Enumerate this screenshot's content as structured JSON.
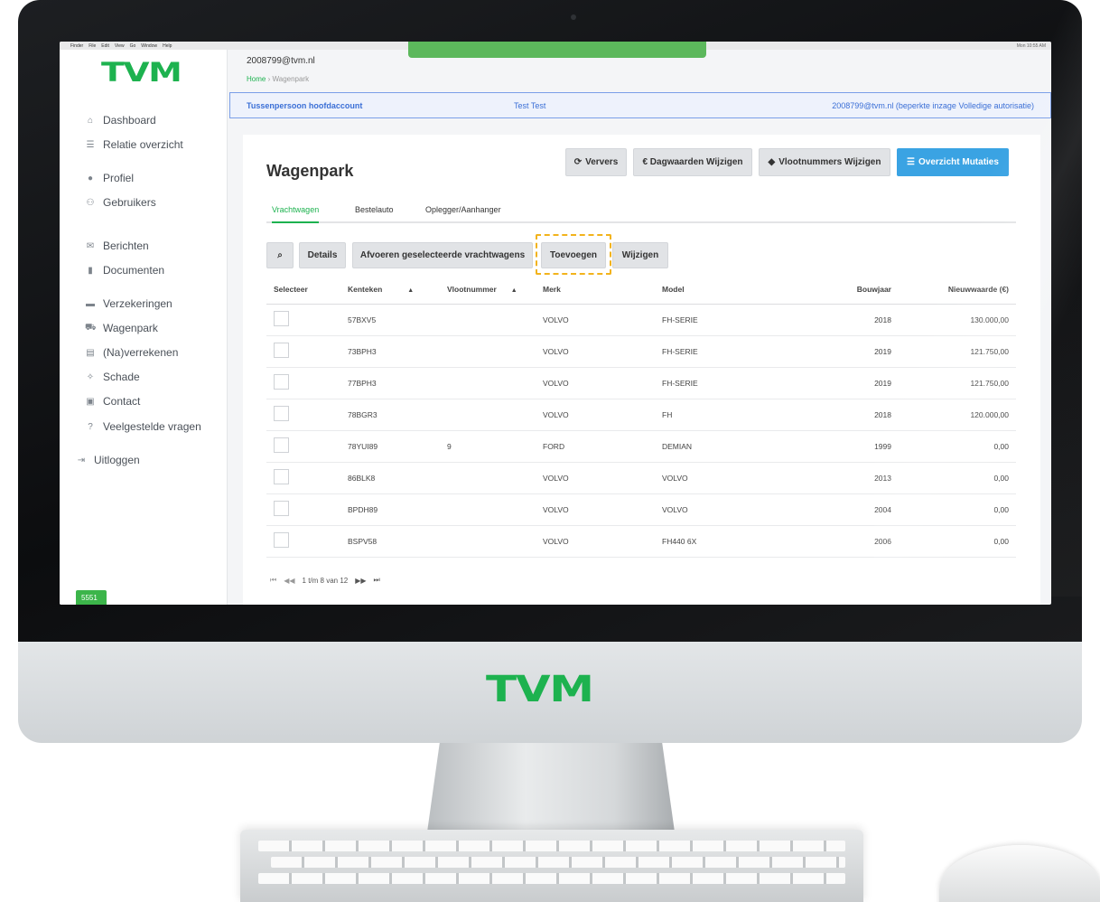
{
  "brand": {
    "logo": "TVM",
    "accent": "#1db24f",
    "info_blue": "#3b6fd6",
    "highlight": "#f2b31c"
  },
  "os_menubar": {
    "items": [
      "Finder",
      "File",
      "Edit",
      "View",
      "Go",
      "Window",
      "Help"
    ],
    "clock": "Mon 10:55 AM"
  },
  "top_banner": "",
  "sidebar": {
    "items": [
      {
        "label": "Dashboard",
        "icon": "home-icon",
        "glyph": "⌂"
      },
      {
        "label": "Relatie overzicht",
        "icon": "list-icon",
        "glyph": "☰"
      },
      {
        "label": "Profiel",
        "icon": "user-icon",
        "glyph": "●"
      },
      {
        "label": "Gebruikers",
        "icon": "users-icon",
        "glyph": "⚇"
      },
      {
        "label": "Berichten",
        "icon": "envelope-icon",
        "glyph": "✉"
      },
      {
        "label": "Documenten",
        "icon": "file-icon",
        "glyph": "▮"
      },
      {
        "label": "Verzekeringen",
        "icon": "folder-icon",
        "glyph": "▬"
      },
      {
        "label": "Wagenpark",
        "icon": "truck-icon",
        "glyph": "⛟"
      },
      {
        "label": "(Na)verrekenen",
        "icon": "calculator-icon",
        "glyph": "▤"
      },
      {
        "label": "Schade",
        "icon": "car-crash-icon",
        "glyph": "✧"
      },
      {
        "label": "Contact",
        "icon": "contact-card-icon",
        "glyph": "▣"
      },
      {
        "label": "Veelgestelde vragen",
        "icon": "question-icon",
        "glyph": "?"
      }
    ],
    "logout": {
      "label": "Uitloggen",
      "icon": "sign-out-icon",
      "glyph": "⇥"
    },
    "version": "5551"
  },
  "header": {
    "user_email": "2008799@tvm.nl",
    "breadcrumb": {
      "home": "Home",
      "separator": "›",
      "current": "Wagenpark"
    }
  },
  "infobar": {
    "account_type": "Tussenpersoon hoofdaccount",
    "name": "Test Test",
    "authorization": "2008799@tvm.nl (beperkte inzage Volledige autorisatie)"
  },
  "page": {
    "title": "Wagenpark",
    "actions": {
      "refresh": "Ververs",
      "day_values": "€ Dagwaarden Wijzigen",
      "fleet_numbers": "Vlootnummers Wijzigen",
      "mutations": "Overzicht Mutaties"
    },
    "tabs": [
      "Vrachtwagen",
      "Bestelauto",
      "Oplegger/Aanhanger"
    ],
    "active_tab": "Vrachtwagen",
    "toolbar": {
      "details": "Details",
      "dispose": "Afvoeren geselecteerde vrachtwagens",
      "add": "Toevoegen",
      "edit": "Wijzigen"
    }
  },
  "table": {
    "columns": [
      "Selecteer",
      "Kenteken",
      "Vlootnummer",
      "Merk",
      "Model",
      "Bouwjaar",
      "Nieuwwaarde (€)"
    ],
    "rows": [
      {
        "kenteken": "57BXV5",
        "vlootnummer": "",
        "merk": "VOLVO",
        "model": "FH-SERIE",
        "bouwjaar": "2018",
        "nieuwwaarde": "130.000,00"
      },
      {
        "kenteken": "73BPH3",
        "vlootnummer": "",
        "merk": "VOLVO",
        "model": "FH-SERIE",
        "bouwjaar": "2019",
        "nieuwwaarde": "121.750,00"
      },
      {
        "kenteken": "77BPH3",
        "vlootnummer": "",
        "merk": "VOLVO",
        "model": "FH-SERIE",
        "bouwjaar": "2019",
        "nieuwwaarde": "121.750,00"
      },
      {
        "kenteken": "78BGR3",
        "vlootnummer": "",
        "merk": "VOLVO",
        "model": "FH",
        "bouwjaar": "2018",
        "nieuwwaarde": "120.000,00"
      },
      {
        "kenteken": "78YUI89",
        "vlootnummer": "9",
        "merk": "FORD",
        "model": "DEMIAN",
        "bouwjaar": "1999",
        "nieuwwaarde": "0,00"
      },
      {
        "kenteken": "86BLK8",
        "vlootnummer": "",
        "merk": "VOLVO",
        "model": "VOLVO",
        "bouwjaar": "2013",
        "nieuwwaarde": "0,00"
      },
      {
        "kenteken": "BPDH89",
        "vlootnummer": "",
        "merk": "VOLVO",
        "model": "VOLVO",
        "bouwjaar": "2004",
        "nieuwwaarde": "0,00"
      },
      {
        "kenteken": "BSPV58",
        "vlootnummer": "",
        "merk": "VOLVO",
        "model": "FH440 6X",
        "bouwjaar": "2006",
        "nieuwwaarde": "0,00"
      }
    ]
  },
  "pagination": {
    "label": "1 t/m 8 van 12"
  }
}
